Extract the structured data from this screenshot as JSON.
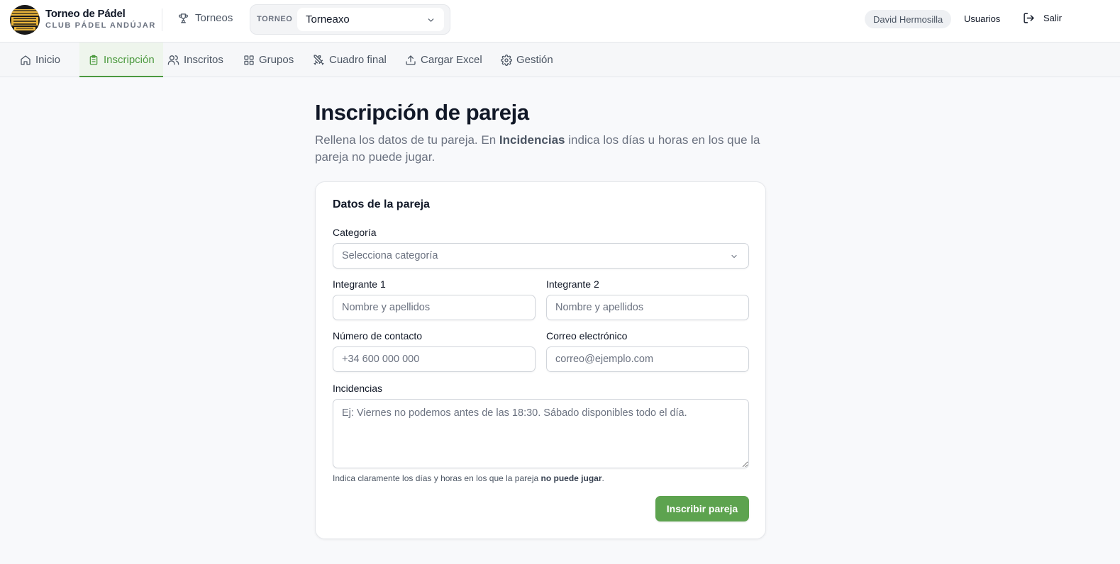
{
  "header": {
    "logo_text": "TORNEO DE PÁDEL",
    "brand_title": "Torneo de Pádel",
    "brand_subtitle": "CLUB PÁDEL ANDÚJAR",
    "torneos_label": "Torneos",
    "torneo_tag": "TORNEO",
    "torneo_selected": "Torneaxo",
    "user_name": "David Hermosilla",
    "usuarios_label": "Usuarios",
    "salir_label": "Salir"
  },
  "nav": {
    "tabs": [
      {
        "label": "Inicio",
        "icon": "home-icon",
        "active": false
      },
      {
        "label": "Inscripción",
        "icon": "clipboard-icon",
        "active": true
      },
      {
        "label": "Inscritos",
        "icon": "users-icon",
        "active": false
      },
      {
        "label": "Grupos",
        "icon": "grid-icon",
        "active": false
      },
      {
        "label": "Cuadro final",
        "icon": "swords-icon",
        "active": false
      },
      {
        "label": "Cargar Excel",
        "icon": "upload-icon",
        "active": false
      },
      {
        "label": "Gestión",
        "icon": "gear-icon",
        "active": false
      }
    ]
  },
  "main": {
    "title": "Inscripción de pareja",
    "desc_before": "Rellena los datos de tu pareja. En ",
    "desc_bold": "Incidencias",
    "desc_after": " indica los días u horas en los que la pareja no puede jugar."
  },
  "form": {
    "card_title": "Datos de la pareja",
    "categoria_label": "Categoría",
    "categoria_placeholder": "Selecciona categoría",
    "integrante1_label": "Integrante 1",
    "integrante1_placeholder": "Nombre y apellidos",
    "integrante2_label": "Integrante 2",
    "integrante2_placeholder": "Nombre y apellidos",
    "telefono_label": "Número de contacto",
    "telefono_placeholder": "+34 600 000 000",
    "email_label": "Correo electrónico",
    "email_placeholder": "correo@ejemplo.com",
    "incidencias_label": "Incidencias",
    "incidencias_placeholder": "Ej: Viernes no podemos antes de las 18:30. Sábado disponibles todo el día.",
    "hint_before": "Indica claramente los días y horas en los que la pareja ",
    "hint_bold": "no puede jugar",
    "hint_after": ".",
    "submit_label": "Inscribir pareja"
  },
  "colors": {
    "accent": "#4c9a3f",
    "button": "#5da34f",
    "logo_gold": "#e8b339"
  }
}
